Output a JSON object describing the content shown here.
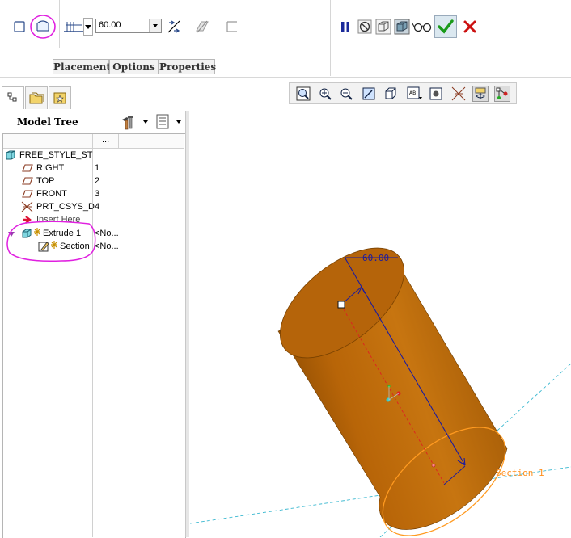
{
  "dashboard": {
    "depth_value": "60.00",
    "tabs": [
      {
        "label": "Placement"
      },
      {
        "label": "Options"
      },
      {
        "label": "Properties"
      }
    ]
  },
  "navigator": {
    "title": "Model Tree",
    "column_header": "...",
    "rows": [
      {
        "label": "FREE_STYLE_ST",
        "col": "",
        "icon": "part-icon"
      },
      {
        "label": "RIGHT",
        "col": "1",
        "icon": "datum-plane-icon"
      },
      {
        "label": "TOP",
        "col": "2",
        "icon": "datum-plane-icon"
      },
      {
        "label": "FRONT",
        "col": "3",
        "icon": "datum-plane-icon"
      },
      {
        "label": "PRT_CSYS_D",
        "col": "4",
        "icon": "csys-icon"
      },
      {
        "label": "Insert Here",
        "col": "",
        "icon": "insert-arrow-icon"
      },
      {
        "label": "Extrude 1",
        "col": "<No...",
        "icon": "extrude-icon"
      },
      {
        "label": "Section",
        "col": "<No...",
        "icon": "sketch-icon"
      }
    ]
  },
  "viewport": {
    "dimension_label": "60.00",
    "section_label": "Section 1"
  },
  "colors": {
    "solid": "#c26f08",
    "highlight": "#e020e0",
    "dimension": "#1a1aa0",
    "accept": "#1a9a1a",
    "cancel": "#cc1111"
  }
}
